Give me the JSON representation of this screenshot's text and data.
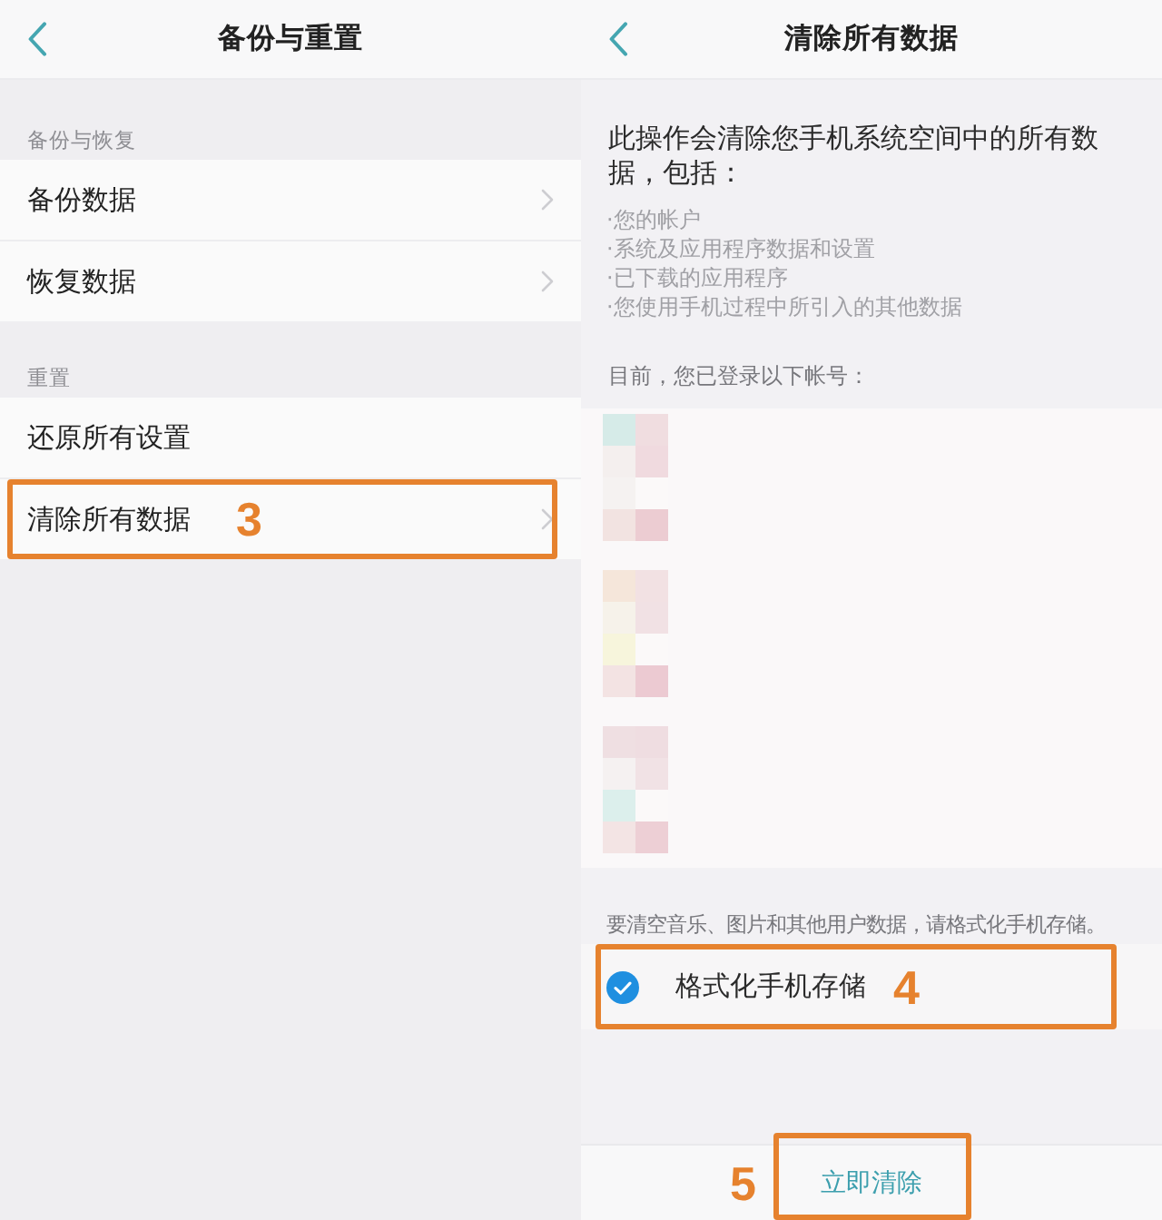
{
  "left_screen": {
    "title": "备份与重置",
    "sections": [
      {
        "header": "备份与恢复",
        "items": [
          {
            "label": "备份数据",
            "chevron": true
          },
          {
            "label": "恢复数据",
            "chevron": true
          }
        ]
      },
      {
        "header": "重置",
        "items": [
          {
            "label": "还原所有设置",
            "chevron": false
          },
          {
            "label": "清除所有数据",
            "chevron": true,
            "callout": "3"
          }
        ]
      }
    ]
  },
  "right_screen": {
    "title": "清除所有数据",
    "intro": "此操作会清除您手机系统空间中的所有数据，包括：",
    "bullets": [
      "·您的帐户",
      "·系统及应用程序数据和设置",
      "·已下载的应用程序",
      "·您使用手机过程中所引入的其他数据"
    ],
    "accounts_label": "目前，您已登录以下帐号：",
    "format_notice": "要清空音乐、图片和其他用户数据，请格式化手机存储。",
    "format_option": {
      "label": "格式化手机存储",
      "checked": true,
      "callout": "4"
    },
    "action_button": {
      "label": "立即清除",
      "callout": "5"
    }
  }
}
